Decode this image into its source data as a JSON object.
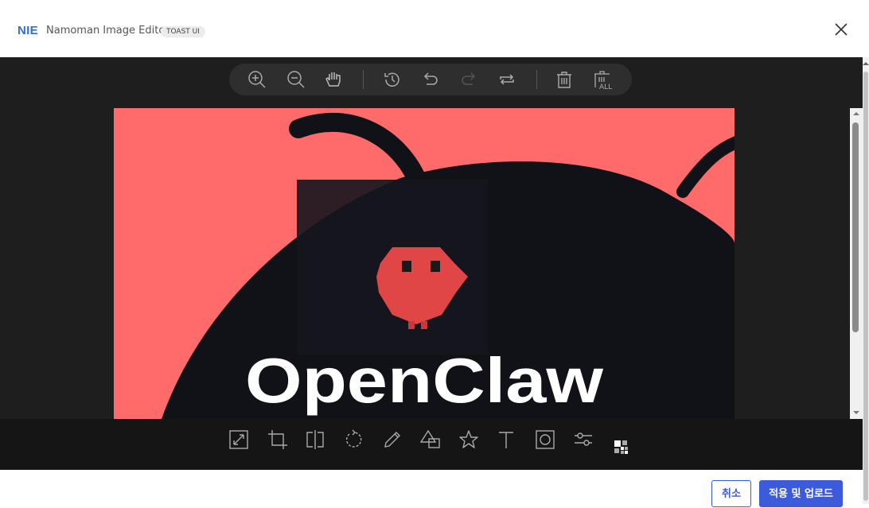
{
  "header": {
    "brand": "NIE",
    "title": "Namoman Image Editor",
    "badge": "TOAST UI",
    "close_icon": "close-icon"
  },
  "top_toolbar": {
    "items": [
      {
        "name": "zoom-in",
        "icon": "zoom-in-icon"
      },
      {
        "name": "zoom-out",
        "icon": "zoom-out-icon"
      },
      {
        "name": "hand",
        "icon": "hand-icon"
      },
      {
        "name": "history",
        "icon": "history-icon"
      },
      {
        "name": "undo",
        "icon": "undo-icon"
      },
      {
        "name": "redo",
        "icon": "redo-icon",
        "disabled": true
      },
      {
        "name": "reset",
        "icon": "reset-icon"
      },
      {
        "name": "delete",
        "icon": "trash-icon"
      },
      {
        "name": "delete-all",
        "icon": "trash-all-icon",
        "label": "ALL"
      }
    ]
  },
  "canvas": {
    "image_text": "OpenClaw",
    "background_color": "#ff6b6b",
    "shape_color": "#111118"
  },
  "bottom_toolbar": {
    "items": [
      {
        "name": "resize",
        "icon": "resize-icon"
      },
      {
        "name": "crop",
        "icon": "crop-icon"
      },
      {
        "name": "flip",
        "icon": "flip-icon"
      },
      {
        "name": "rotate",
        "icon": "rotate-icon"
      },
      {
        "name": "draw",
        "icon": "pencil-icon"
      },
      {
        "name": "shape",
        "icon": "shape-icon"
      },
      {
        "name": "icon",
        "icon": "star-icon"
      },
      {
        "name": "text",
        "icon": "text-icon"
      },
      {
        "name": "mask",
        "icon": "mask-icon"
      },
      {
        "name": "filter",
        "icon": "filter-icon"
      },
      {
        "name": "mosaic",
        "icon": "mosaic-icon"
      }
    ]
  },
  "footer": {
    "cancel_label": "취소",
    "apply_label": "적용 및 업로드"
  },
  "colors": {
    "accent": "#3b5bdb",
    "brand": "#2f6fd6",
    "editor_bg": "#1e1e1e"
  }
}
